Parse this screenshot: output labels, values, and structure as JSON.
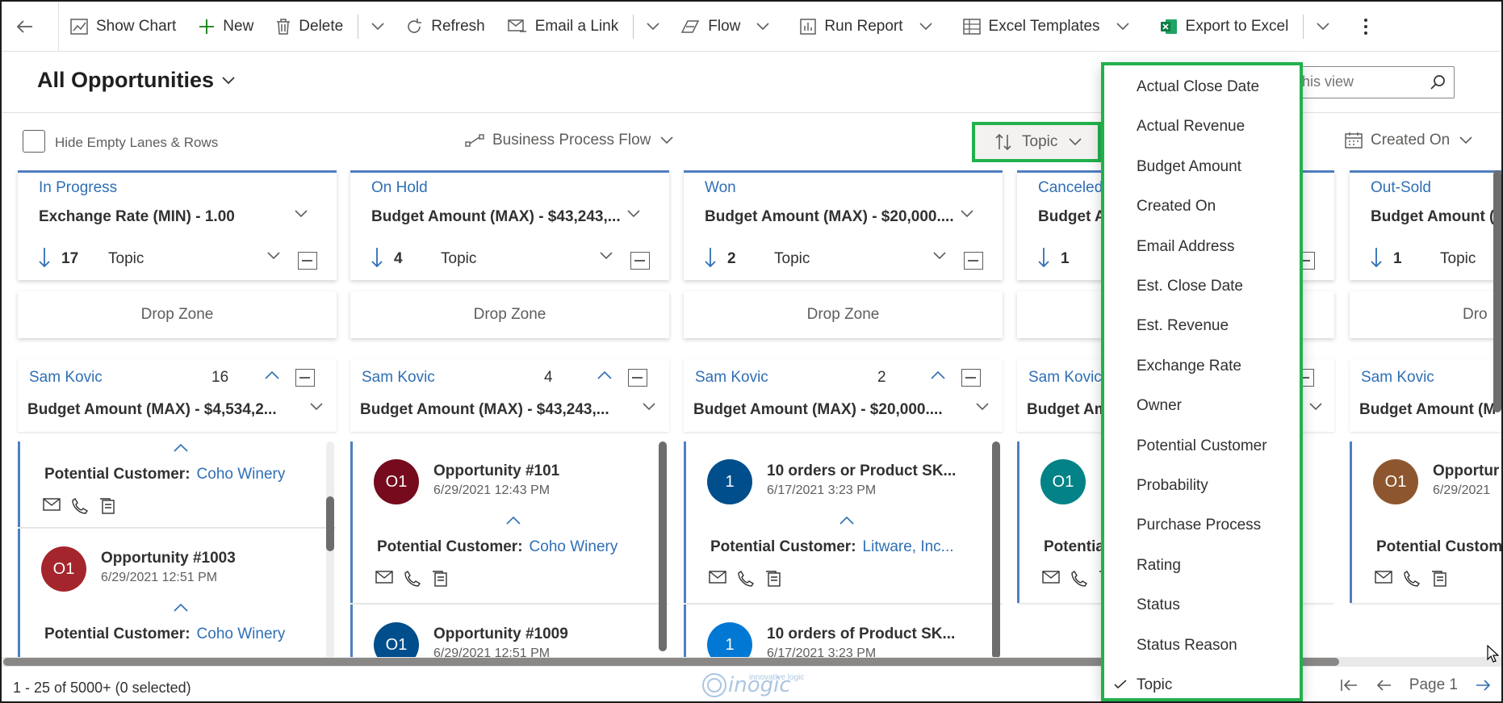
{
  "commands": {
    "show_chart": "Show Chart",
    "new": "New",
    "delete": "Delete",
    "refresh": "Refresh",
    "email_link": "Email a Link",
    "flow": "Flow",
    "run_report": "Run Report",
    "excel_templates": "Excel Templates",
    "export_excel": "Export to Excel"
  },
  "view": {
    "title": "All Opportunities",
    "search_placeholder": "his view"
  },
  "filters": {
    "hide_empty": "Hide Empty Lanes & Rows",
    "bpf": "Business Process Flow",
    "sort_field": "Topic",
    "created_on": "Created On"
  },
  "lanes": [
    {
      "name": "In Progress",
      "aggregate": "Exchange Rate (MIN) - 1.00",
      "count": "17",
      "sort_by": "Topic",
      "drop_zone": "Drop Zone",
      "group": {
        "owner": "Sam Kovic",
        "count": "16",
        "aggregate": "Budget Amount (MAX) - $4,534,2..."
      },
      "cards": [
        {
          "partial": true,
          "customer_label": "Potential Customer:",
          "customer": "Coho Winery"
        },
        {
          "avatar": "O1",
          "color": "#a4262c",
          "title": "Opportunity #1003",
          "date": "6/29/2021 12:51 PM",
          "customer_label": "Potential Customer:",
          "customer": "Coho Winery"
        }
      ]
    },
    {
      "name": "On Hold",
      "aggregate": "Budget Amount (MAX) - $43,243,...",
      "count": "4",
      "sort_by": "Topic",
      "drop_zone": "Drop Zone",
      "group": {
        "owner": "Sam Kovic",
        "count": "4",
        "aggregate": "Budget Amount (MAX) - $43,243,..."
      },
      "cards": [
        {
          "avatar": "O1",
          "color": "#750b1c",
          "title": "Opportunity #101",
          "date": "6/29/2021 12:43 PM",
          "customer_label": "Potential Customer:",
          "customer": "Coho Winery"
        },
        {
          "avatar": "O1",
          "color": "#004e8c",
          "title": "Opportunity #1009",
          "date": "6/29/2021 12:51 PM"
        }
      ]
    },
    {
      "name": "Won",
      "aggregate": "Budget Amount (MAX) - $20,000....",
      "count": "2",
      "sort_by": "Topic",
      "drop_zone": "Drop Zone",
      "group": {
        "owner": "Sam Kovic",
        "count": "2",
        "aggregate": "Budget Amount (MAX) - $20,000...."
      },
      "cards": [
        {
          "avatar": "1",
          "color": "#004e8c",
          "title": "10 orders or Product SK...",
          "date": "6/17/2021 3:23 PM",
          "customer_label": "Potential Customer:",
          "customer": "Litware, Inc..."
        },
        {
          "avatar": "1",
          "color": "#0078d4",
          "title": "10 orders of Product SK...",
          "date": "6/17/2021 3:23 PM"
        }
      ]
    },
    {
      "name": "Canceled",
      "aggregate": "Budget A",
      "count": "1",
      "sort_by": "",
      "drop_zone": "",
      "group": {
        "owner": "Sam Kovic",
        "count": "",
        "aggregate": "Budget Am"
      },
      "cards": [
        {
          "avatar": "O1",
          "color": "#038387",
          "title": "",
          "date": "",
          "customer_label": "Potentia",
          "customer": ""
        }
      ]
    },
    {
      "name": "Out-Sold",
      "aggregate": "Budget Amount (",
      "count": "1",
      "sort_by": "Topic",
      "drop_zone": "Dro",
      "group": {
        "owner": "Sam Kovic",
        "count": "",
        "aggregate": "Budget Amount (M"
      },
      "cards": [
        {
          "avatar": "O1",
          "color": "#8e562e",
          "title": "Opportur",
          "date": "6/29/2021",
          "customer_label": "Potential Custom",
          "customer": ""
        }
      ]
    }
  ],
  "sort_menu": {
    "items": [
      "Actual Close Date",
      "Actual Revenue",
      "Budget Amount",
      "Created On",
      "Email Address",
      "Est. Close Date",
      "Est. Revenue",
      "Exchange Rate",
      "Owner",
      "Potential Customer",
      "Probability",
      "Purchase Process",
      "Rating",
      "Status",
      "Status Reason",
      "Topic"
    ],
    "selected": "Topic"
  },
  "status": {
    "record_count": "1 - 25 of 5000+ (0 selected)",
    "page": "Page 1"
  },
  "logo": {
    "brand": "inogic",
    "tagline": "innovative logic"
  },
  "colors": {
    "accent": "#2f6fb5",
    "highlight": "#22b14c"
  }
}
